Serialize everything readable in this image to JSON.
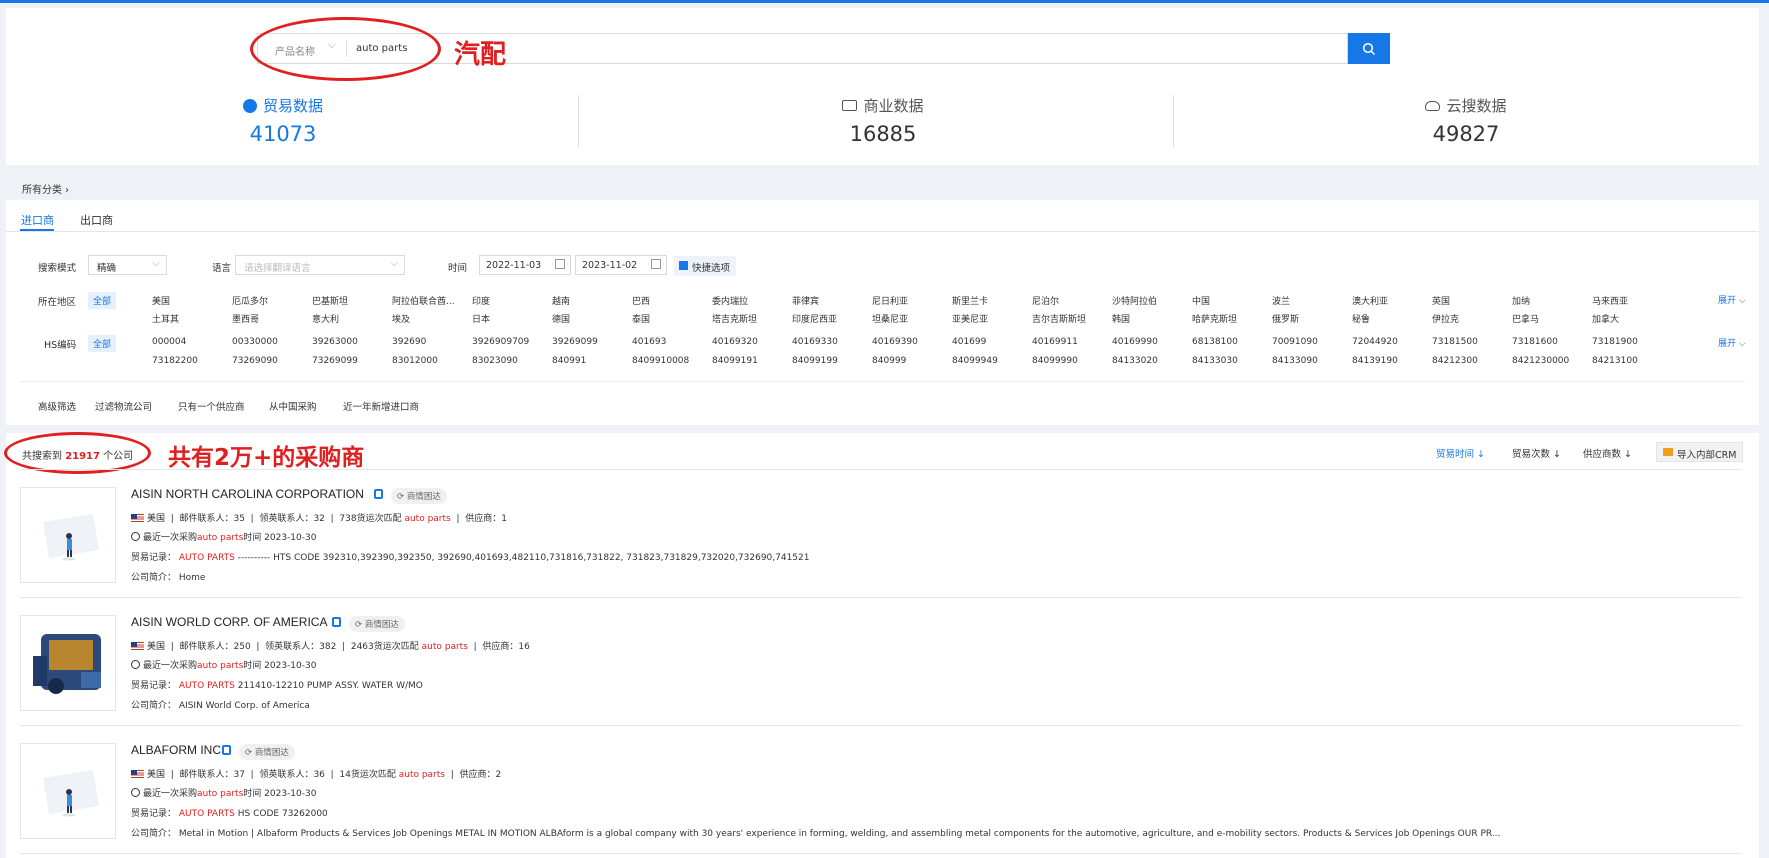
{
  "search": {
    "type_label": "产品名称",
    "value": "auto parts",
    "annotation": "汽配"
  },
  "stats": [
    {
      "label": "贸易数据",
      "value": "41073",
      "icon": "globe-icon"
    },
    {
      "label": "商业数据",
      "value": "16885",
      "icon": "monitor-icon"
    },
    {
      "label": "云搜数据",
      "value": "49827",
      "icon": "cloud-search-icon"
    }
  ],
  "breadcrumb": "所有分类",
  "tabs": [
    "进口商",
    "出口商"
  ],
  "filters": {
    "mode_label": "搜索模式",
    "mode_value": "精确",
    "language_label": "语言",
    "language_placeholder": "请选择翻译语言",
    "time_label": "时间",
    "date_from": "2022-11-03",
    "date_to": "2023-11-02",
    "quick_label": "快捷选项",
    "region_label": "所在地区",
    "all_label": "全部",
    "expand_label": "展开",
    "regions_row1": [
      "美国",
      "厄瓜多尔",
      "巴基斯坦",
      "阿拉伯联合酋...",
      "印度",
      "越南",
      "巴西",
      "委内瑞拉",
      "菲律宾",
      "尼日利亚",
      "斯里兰卡",
      "尼泊尔",
      "沙特阿拉伯",
      "中国",
      "波兰",
      "澳大利亚",
      "英国",
      "加纳",
      "马来西亚"
    ],
    "regions_row2": [
      "土耳其",
      "墨西哥",
      "意大利",
      "埃及",
      "日本",
      "德国",
      "泰国",
      "塔吉克斯坦",
      "印度尼西亚",
      "坦桑尼亚",
      "亚美尼亚",
      "吉尔吉斯斯坦",
      "韩国",
      "哈萨克斯坦",
      "俄罗斯",
      "秘鲁",
      "伊拉克",
      "巴拿马",
      "加拿大"
    ],
    "hs_label": "HS编码",
    "hs_row1": [
      "000004",
      "00330000",
      "39263000",
      "392690",
      "3926909709",
      "39269099",
      "401693",
      "40169320",
      "40169330",
      "40169390",
      "401699",
      "40169911",
      "40169990",
      "68138100",
      "70091090",
      "72044920",
      "73181500",
      "73181600",
      "73181900"
    ],
    "hs_row2": [
      "73182200",
      "73269090",
      "73269099",
      "83012000",
      "83023090",
      "840991",
      "8409910008",
      "84099191",
      "84099199",
      "840999",
      "84099949",
      "84099990",
      "84133020",
      "84133030",
      "84133090",
      "84139190",
      "84212300",
      "8421230000",
      "84213100"
    ],
    "advanced": [
      "高级筛选",
      "过滤物流公司",
      "只有一个供应商",
      "从中国采购",
      "近一年新增进口商"
    ]
  },
  "results": {
    "prefix": "共搜索到",
    "count": "21917",
    "suffix": "个公司",
    "annotation": "共有2万+的采购商",
    "sorts": [
      "贸易时间",
      "贸易次数",
      "供应商数"
    ],
    "crm_label": "导入内部CRM"
  },
  "companies": [
    {
      "name": "AISIN NORTH CAROLINA CORPORATION",
      "chip": "商情困达",
      "country": "美国",
      "email_contacts": "邮件联系人：35",
      "linkedin_contacts": "领英联系人：32",
      "matches_num": "738",
      "matches_text": "货运次匹配",
      "keyword": "auto parts",
      "suppliers": "供应商：1",
      "last_purchase_prefix": "最近一次采购",
      "last_purchase_suffix": "时间 2023-10-30",
      "trade_label": "贸易记录：",
      "trade_kw": "AUTO  PARTS",
      "trade_text": "---------- HTS CODE 392310,392390,392350, 392690,401693,482110,731816,731822, 731823,731829,732020,732690,741521",
      "intro_label": "公司简介：",
      "intro": "Home"
    },
    {
      "name": "AISIN WORLD CORP. OF AMERICA",
      "chip": "商情困达",
      "country": "美国",
      "email_contacts": "邮件联系人：250",
      "linkedin_contacts": "领英联系人：382",
      "matches_num": "2463",
      "matches_text": "货运次匹配",
      "keyword": "auto parts",
      "suppliers": "供应商：16",
      "last_purchase_prefix": "最近一次采购",
      "last_purchase_suffix": "时间 2023-10-30",
      "trade_label": "贸易记录：",
      "trade_kw": "AUTO  PARTS",
      "trade_text": "211410-12210 PUMP ASSY. WATER W/MO",
      "intro_label": "公司简介：",
      "intro": "AISIN World Corp. of America"
    },
    {
      "name": "ALBAFORM INC",
      "chip": "商情困达",
      "country": "美国",
      "email_contacts": "邮件联系人：37",
      "linkedin_contacts": "领英联系人：36",
      "matches_num": "14",
      "matches_text": "货运次匹配",
      "keyword": "auto parts",
      "suppliers": "供应商：2",
      "last_purchase_prefix": "最近一次采购",
      "last_purchase_suffix": "时间 2023-10-30",
      "trade_label": "贸易记录：",
      "trade_kw": "AUTO  PARTS",
      "trade_text": "HS CODE 73262000",
      "intro_label": "公司简介：",
      "intro": "Metal in Motion | Albaform Products & Services Job Openings METAL IN MOTION ALBAform is a global company with 30 years' experience in forming, welding, and assembling metal components for the automotive, agriculture, and e-mobility sectors. Products & Services Job Openings OUR PR..."
    }
  ],
  "colors": {
    "accent": "#1677e6",
    "highlight": "#e02020"
  }
}
